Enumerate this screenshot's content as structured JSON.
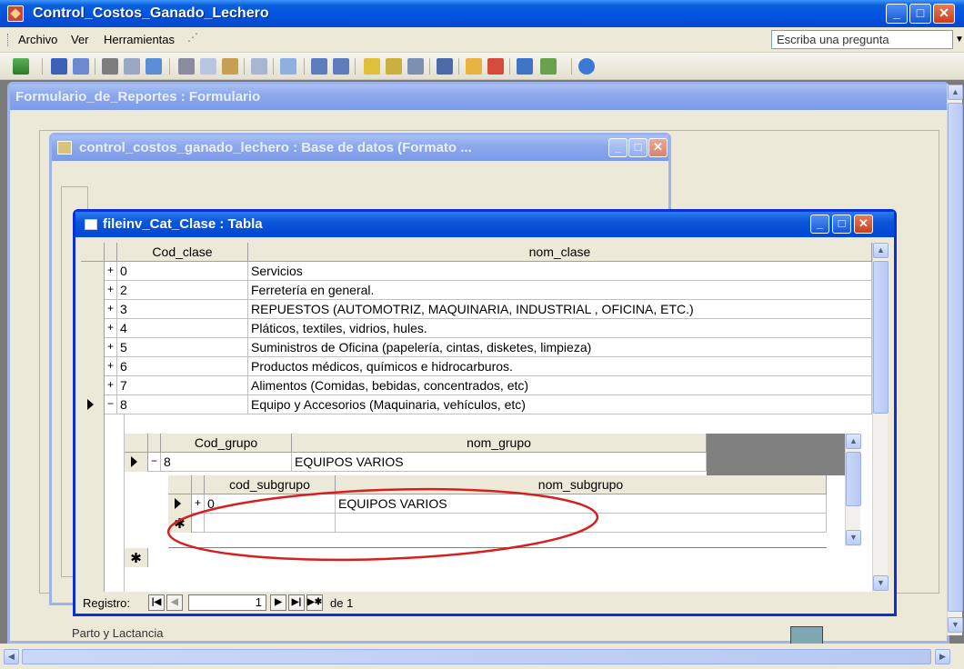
{
  "app": {
    "title": "Control_Costos_Ganado_Lechero",
    "menu": [
      "Archivo",
      "Ver",
      "Herramientas"
    ],
    "ask_placeholder": "Escriba una pregunta"
  },
  "form_window": {
    "title": "Formulario_de_Reportes : Formulario",
    "bottom_label": "Parto y Lactancia"
  },
  "db_window": {
    "title": "control_costos_ganado_lechero : Base de datos (Formato ..."
  },
  "table_window": {
    "title": "fileinv_Cat_Clase : Tabla",
    "columns": [
      "Cod_clase",
      "nom_clase"
    ],
    "rows": [
      {
        "cod": "0",
        "nom": "Servicios"
      },
      {
        "cod": "2",
        "nom": "Ferretería en general."
      },
      {
        "cod": "3",
        "nom": "REPUESTOS (AUTOMOTRIZ, MAQUINARIA, INDUSTRIAL , OFICINA, ETC.)"
      },
      {
        "cod": "4",
        "nom": "Pláticos, textiles, vidrios, hules."
      },
      {
        "cod": "5",
        "nom": "Suministros de Oficina (papelería, cintas, disketes, limpieza)"
      },
      {
        "cod": "6",
        "nom": "Productos médicos, químicos e hidrocarburos."
      },
      {
        "cod": "7",
        "nom": "Alimentos (Comidas, bebidas, concentrados, etc)"
      },
      {
        "cod": "8",
        "nom": "Equipo y Accesorios (Maquinaria, vehículos, etc)"
      }
    ],
    "sub1": {
      "columns": [
        "Cod_grupo",
        "nom_grupo"
      ],
      "rows": [
        {
          "cod": "8",
          "nom": "EQUIPOS VARIOS"
        }
      ]
    },
    "sub2": {
      "columns": [
        "cod_subgrupo",
        "nom_subgrupo"
      ],
      "rows": [
        {
          "cod": "0",
          "nom": "EQUIPOS VARIOS"
        }
      ]
    },
    "nav": {
      "label": "Registro:",
      "current": "1",
      "of": "de 1"
    }
  },
  "icons": [
    "view-icon",
    "save-icon",
    "print-icon",
    "spell-icon",
    "cut-icon",
    "copy-icon",
    "paste-icon",
    "undo-icon",
    "sort-asc-icon",
    "sort-desc-icon",
    "filter-icon",
    "find-icon",
    "new-record-icon",
    "delete-record-icon",
    "help-icon"
  ],
  "colors": {
    "xp_blue": "#0054e3",
    "highlight_ellipse": "#d42020",
    "mdi_bg": "#7a7a7a"
  }
}
